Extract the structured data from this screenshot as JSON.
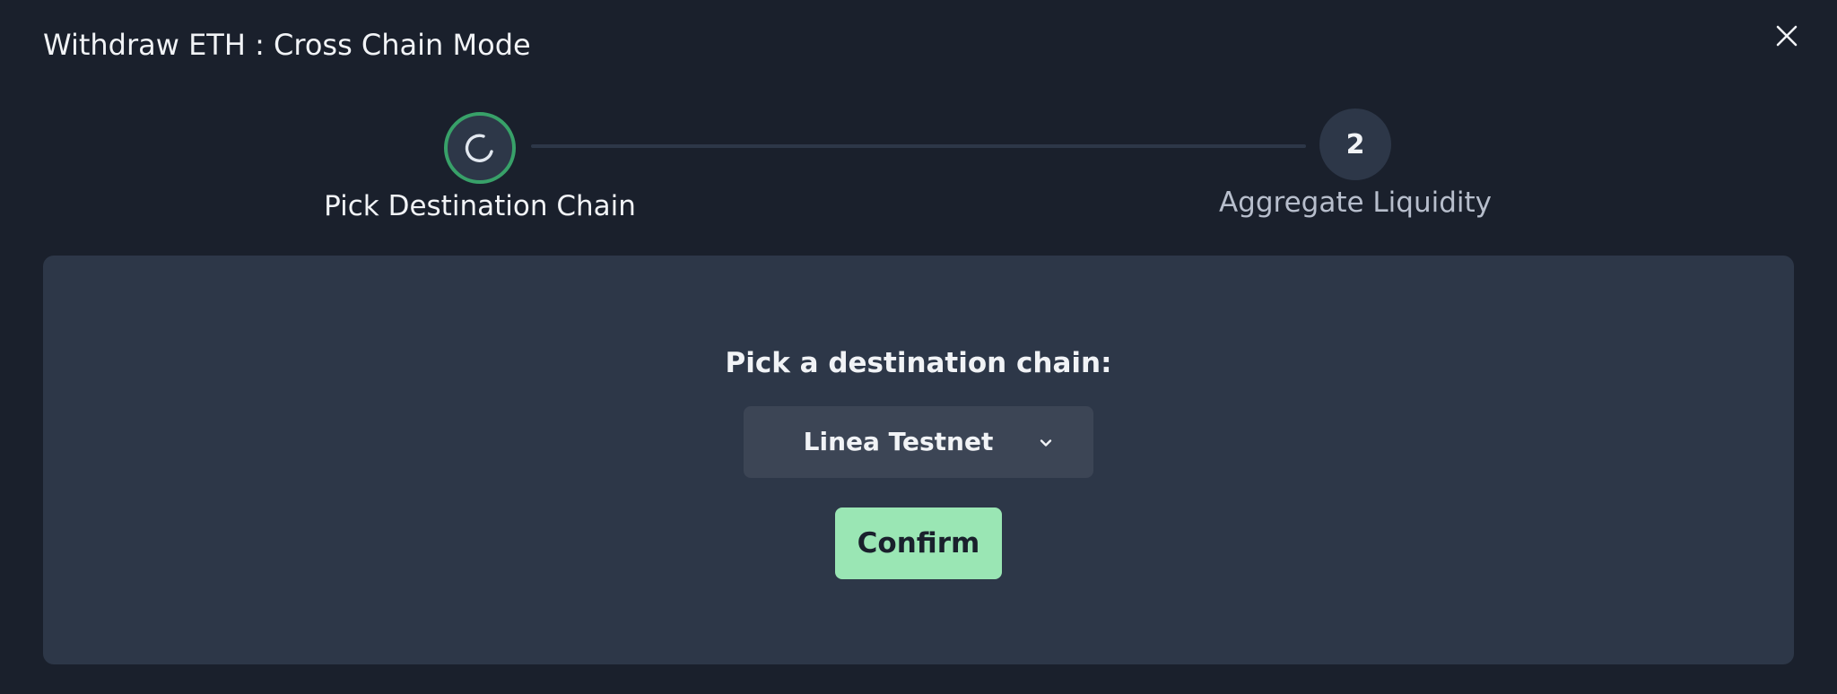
{
  "modal": {
    "title": "Withdraw ETH : Cross Chain Mode"
  },
  "stepper": {
    "steps": [
      {
        "label": "Pick Destination Chain",
        "status": "in-progress",
        "indicator": "spinner-icon"
      },
      {
        "label": "Aggregate Liquidity",
        "status": "pending",
        "number": "2"
      }
    ]
  },
  "panel": {
    "heading": "Pick a destination chain:",
    "chain_select": {
      "selected": "Linea Testnet"
    },
    "confirm_label": "Confirm"
  },
  "colors": {
    "background": "#1a202c",
    "panel": "#2d3748",
    "select_bg": "#3c4555",
    "accent_green": "#38a169",
    "confirm_bg": "#9ae6b4",
    "text_primary": "#f1f3f6",
    "text_muted": "#b7becc"
  }
}
